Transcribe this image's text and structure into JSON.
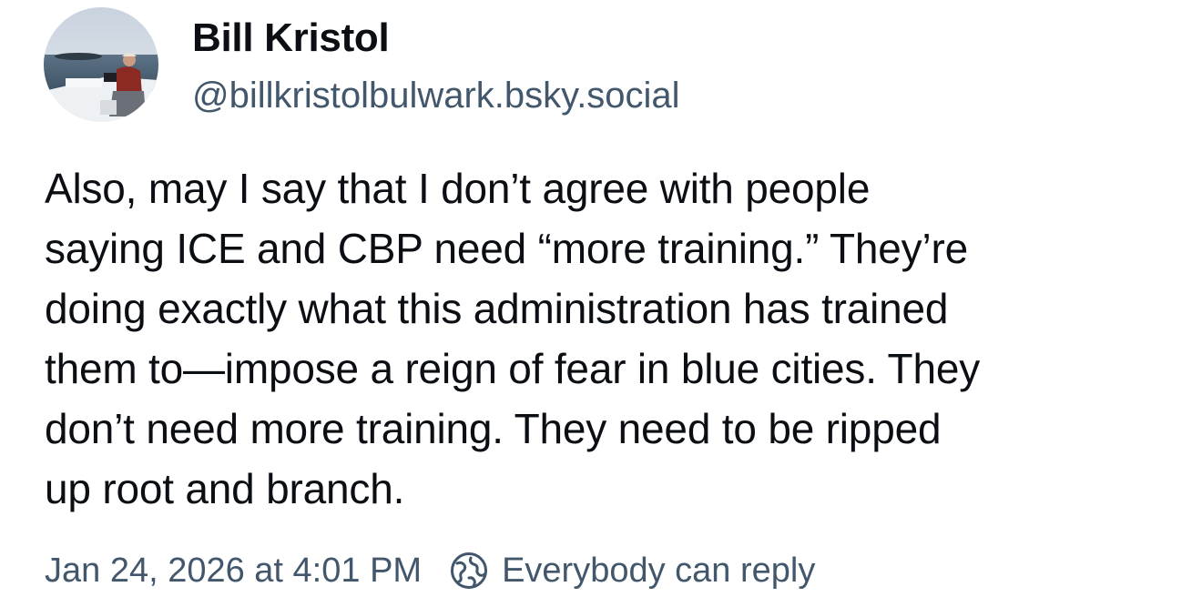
{
  "author": {
    "display_name": "Bill Kristol",
    "handle": "@billkristolbulwark.bsky.social",
    "avatar_icon": "profile-photo"
  },
  "post": {
    "text_lines": [
      "Also, may I say that I don’t agree with people",
      "saying ICE and CBP need “more training.” They’re",
      "doing exactly what this administration has trained",
      "them to—impose a reign of fear in blue cities. They",
      "don’t need more training. They need to be ripped",
      "up root and branch."
    ],
    "timestamp": "Jan 24, 2026 at 4:01 PM",
    "reply_setting": "Everybody can reply",
    "reply_setting_icon": "earth-globe-icon"
  },
  "colors": {
    "text_primary": "#0b0f14",
    "text_secondary": "#42576c",
    "background": "#ffffff"
  }
}
